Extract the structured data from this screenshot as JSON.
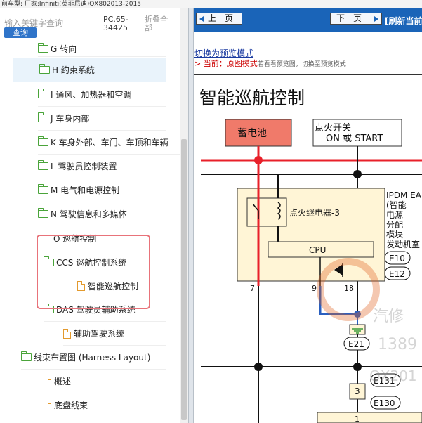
{
  "topstrip": {
    "text": "前车型:  厂家:Infiniti(英菲尼迪)QX802013-2015"
  },
  "search": {
    "placeholder": "输入关键字查询",
    "button_label": "查询"
  },
  "pc_label": "PC.65-34425",
  "fold_all_label": "折叠全部",
  "tree": {
    "items": [
      {
        "label": "G 转向",
        "icon": "folder-icon"
      },
      {
        "label": "H 约束系统",
        "icon": "folder-icon"
      },
      {
        "label": "I 通风、加热器和空调",
        "icon": "folder-icon"
      },
      {
        "label": "J 车身内部",
        "icon": "folder-icon"
      },
      {
        "label": "K 车身外部、车门、车顶和车辆",
        "icon": "folder-icon"
      },
      {
        "label": "L 驾驶员控制装置",
        "icon": "folder-icon"
      },
      {
        "label": "M 电气和电源控制",
        "icon": "folder-icon"
      },
      {
        "label": "N 驾驶信息和多媒体",
        "icon": "folder-icon"
      },
      {
        "label": "O 巡航控制",
        "icon": "open-folder-icon"
      },
      {
        "label": "CCS 巡航控制系统",
        "icon": "open-folder-icon"
      },
      {
        "label": "智能巡航控制",
        "icon": "document-icon"
      },
      {
        "label": "DAS 驾驶员辅助系统",
        "icon": "open-folder-icon"
      },
      {
        "label": "辅助驾驶系统",
        "icon": "document-icon"
      },
      {
        "label": "线束布置图 (Harness Layout)",
        "icon": "open-folder-icon"
      },
      {
        "label": "概述",
        "icon": "document-icon"
      },
      {
        "label": "底盘线束",
        "icon": "document-icon"
      }
    ]
  },
  "nav": {
    "prev_label": "上一页",
    "next_label": "下一页",
    "refresh_label": "[刷新当前"
  },
  "content": {
    "preview_link": "切换为预览模式",
    "current_prefix": "> 当前：",
    "current_mode": "原图模式",
    "current_hint": "若看看预览图，切换至预览模式",
    "page_title": "智能巡航控制"
  },
  "diagram": {
    "battery_label": "蓄电池",
    "ignition_label_1": "点火开关",
    "ignition_label_2": "ON 或 START",
    "relay_label": "点火继电器-3",
    "cpu_label": "CPU",
    "ipdm_lines": [
      "IPDM EA",
      "(智能",
      "电源",
      "分配",
      "模块",
      "发动机室"
    ],
    "connectors": [
      "E10",
      "E12",
      "E21",
      "E131",
      "E130"
    ],
    "pin_labels": [
      "7",
      "9",
      "18",
      "3",
      "1"
    ],
    "colors": {
      "battery_fill": "#f07a6a",
      "wire_red": "#e8202a",
      "wire_blue": "#2a5fbf",
      "module_fill": "#fff5d6",
      "ground_green": "#3a9a3a"
    }
  },
  "watermark": {
    "text_1": "汽修",
    "text_2": "1389",
    "text_3": "QX201"
  }
}
